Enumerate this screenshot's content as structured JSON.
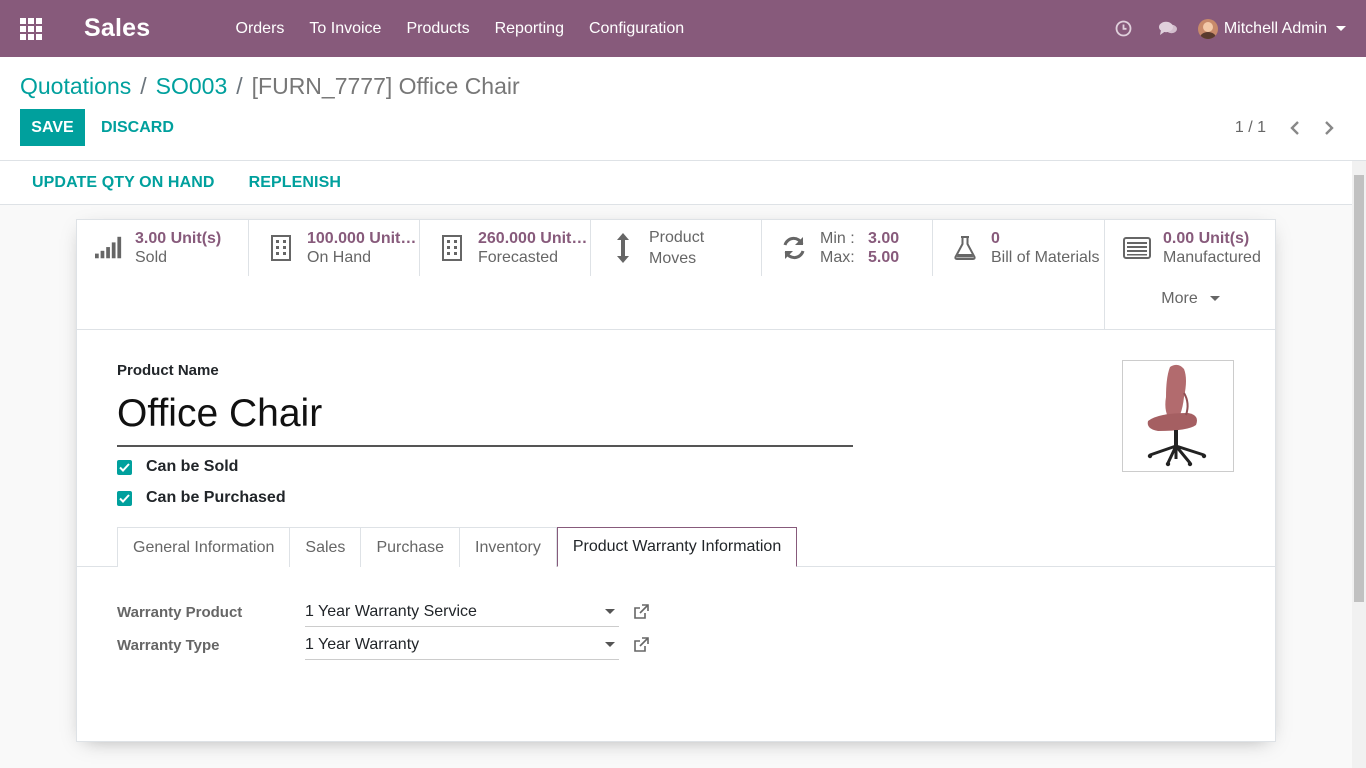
{
  "app": {
    "name": "Sales",
    "menu": [
      "Orders",
      "To Invoice",
      "Products",
      "Reporting",
      "Configuration"
    ],
    "user": "Mitchell Admin"
  },
  "breadcrumb": {
    "items": [
      "Quotations",
      "SO003"
    ],
    "current": "[FURN_7777] Office Chair"
  },
  "actions": {
    "save": "SAVE",
    "discard": "DISCARD"
  },
  "pager": {
    "value": "1 / 1"
  },
  "statusbar": {
    "update_qty": "UPDATE QTY ON HAND",
    "replenish": "REPLENISH"
  },
  "smart_buttons": {
    "sold": {
      "value": "3.00 Unit(s)",
      "label": "Sold"
    },
    "on_hand": {
      "value": "100.000 Unit(s)",
      "label": "On Hand"
    },
    "forecasted": {
      "value": "260.000 Unit(s)",
      "label": "Forecasted"
    },
    "moves": {
      "line1": "Product",
      "line2": "Moves"
    },
    "reorder": {
      "min_label": "Min :",
      "min": "3.00",
      "max_label": "Max:",
      "max": "5.00"
    },
    "bom": {
      "value": "0",
      "label": "Bill of Materials"
    },
    "manufactured": {
      "value": "0.00 Unit(s)",
      "label": "Manufactured"
    },
    "more": "More"
  },
  "product": {
    "name_label": "Product Name",
    "name": "Office Chair",
    "can_be_sold": "Can be Sold",
    "can_be_purchased": "Can be Purchased"
  },
  "tabs": [
    "General Information",
    "Sales",
    "Purchase",
    "Inventory",
    "Product Warranty Information"
  ],
  "warranty": {
    "product_label": "Warranty Product",
    "product_value": "1 Year Warranty Service",
    "type_label": "Warranty Type",
    "type_value": "1 Year Warranty"
  },
  "colors": {
    "brand": "#875a7b",
    "accent": "#00a09d"
  }
}
